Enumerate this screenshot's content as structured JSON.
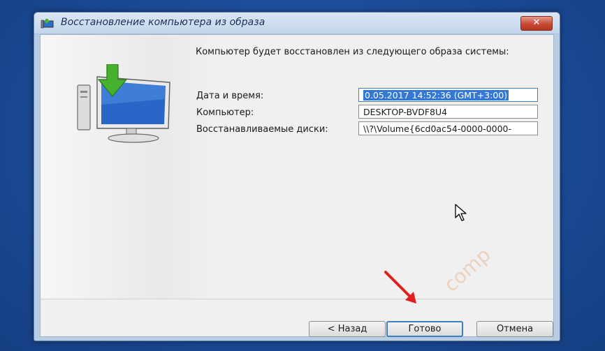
{
  "window": {
    "title": "Восстановление компьютера из образа",
    "close_glyph": "✕"
  },
  "content": {
    "description": "Компьютер будет восстановлен из следующего образа системы:",
    "fields": [
      {
        "label": "Дата и время:",
        "value": "0.05.2017 14:52:36 (GMT+3:00)",
        "selected": true
      },
      {
        "label": "Компьютер:",
        "value": "DESKTOP-BVDF8U4",
        "selected": false
      },
      {
        "label": "Восстанавливаемые диски:",
        "value": "\\\\?\\Volume{6cd0ac54-0000-0000-",
        "selected": false
      }
    ]
  },
  "buttons": {
    "back": "< Назад",
    "finish": "Готово",
    "cancel": "Отмена"
  },
  "watermark": "comp",
  "colors": {
    "desktop": "#1b4a95",
    "titlebar": "#c3d5ea",
    "close": "#c74a35",
    "selection": "#3478d4",
    "default_button_border": "#3c7fc3",
    "annotation_arrow": "#e02020"
  },
  "icons": [
    "restore-computer-icon",
    "window-app-icon",
    "mouse-cursor-icon",
    "annotation-arrow-icon"
  ]
}
